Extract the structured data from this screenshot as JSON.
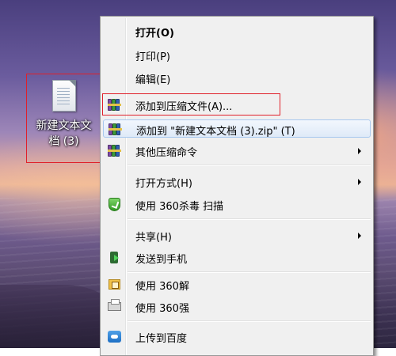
{
  "desktop": {
    "file_icon": {
      "label_line1": "新建文本文",
      "label_line2": "档 (3)"
    }
  },
  "context_menu": {
    "items": [
      {
        "label": "打开(O)",
        "icon": ""
      },
      {
        "label": "打印(P)",
        "icon": ""
      },
      {
        "label": "编辑(E)",
        "icon": ""
      },
      {
        "label": "添加到压缩文件(A)...",
        "icon": "winrar-icon"
      },
      {
        "label": "添加到 \"新建文本文档 (3).zip\" (T)",
        "icon": "winrar-icon"
      },
      {
        "label": "其他压缩命令",
        "icon": "winrar-icon",
        "submenu": true
      },
      {
        "label": "打开方式(H)",
        "icon": "",
        "submenu": true
      },
      {
        "label": "使用 360杀毒 扫描",
        "icon": "360-shield-icon"
      },
      {
        "label": "共享(H)",
        "icon": "",
        "submenu": true
      },
      {
        "label": "发送到手机",
        "icon": "phone-send-icon"
      },
      {
        "label": "使用 360解",
        "icon": "360-unzip-icon"
      },
      {
        "label": "使用 360强",
        "icon": "360-shred-icon"
      },
      {
        "label": "上传到百度",
        "icon": "baidu-cloud-icon"
      }
    ],
    "hovered_item": "添加到 \"新建文本文档 (3).zip\" (T)"
  },
  "colors": {
    "highlight_box": "#e0202a",
    "menu_bg": "#f0f0f0",
    "hover_border": "#a7c8ee"
  }
}
